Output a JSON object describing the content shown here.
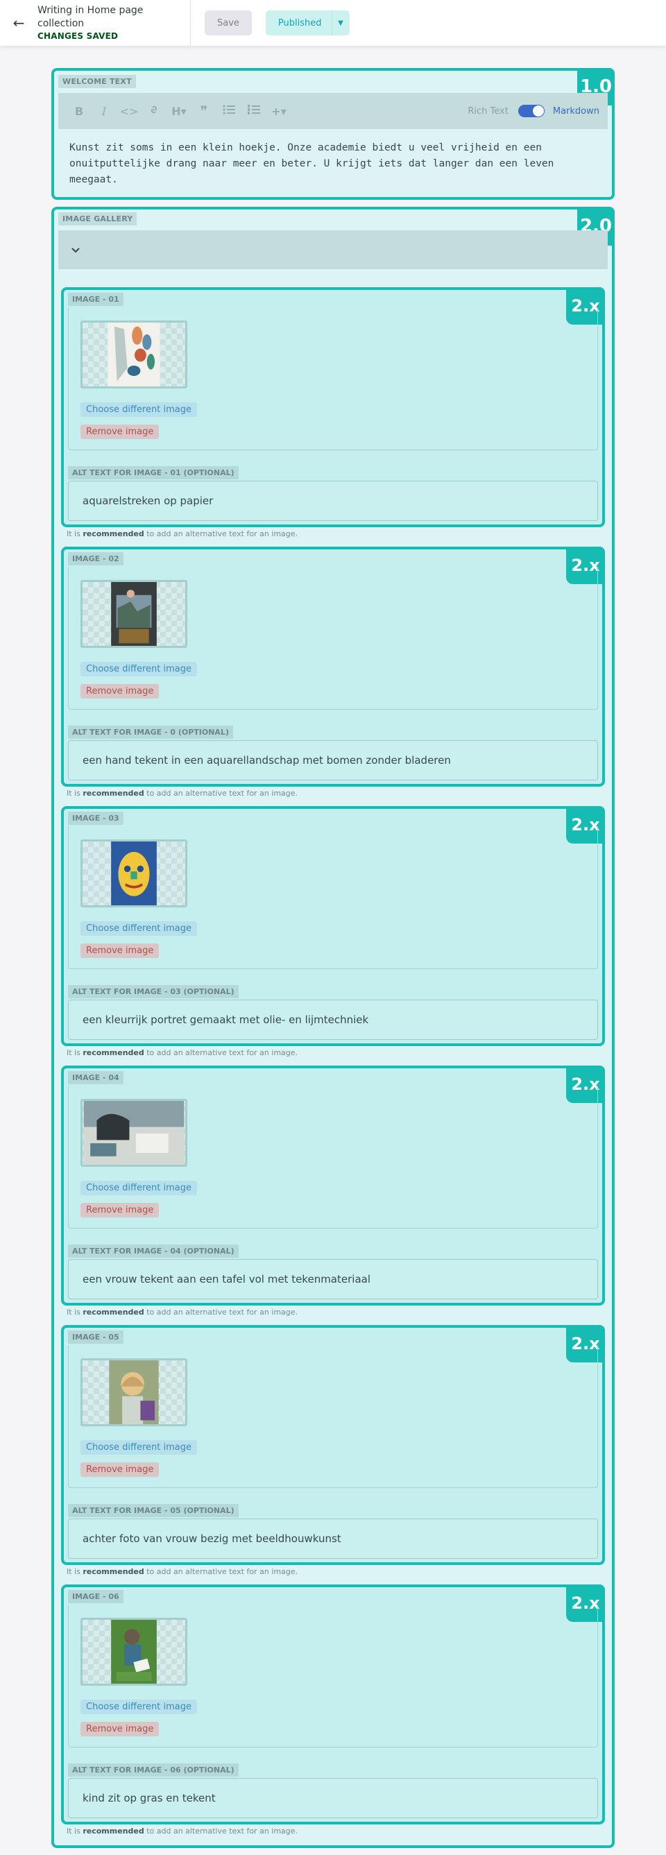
{
  "topbar": {
    "back_icon": "arrow-left-icon",
    "back_glyph": "←",
    "title": "Writing in Home page collection",
    "status": "CHANGES SAVED",
    "save_label": "Save",
    "publish_label": "Published",
    "publish_caret": "▼"
  },
  "welcome": {
    "label": "WELCOME TEXT",
    "badge": "1.0",
    "toolbar": {
      "bold": "B",
      "italic": "I",
      "code": "<>",
      "link": "🔗",
      "heading": "H▾",
      "quote": "❞",
      "bullets": "☰",
      "numbered": "☷",
      "add": "+▾",
      "rich_text": "Rich Text",
      "markdown": "Markdown"
    },
    "text": "Kunst zit soms in een klein hoekje. Onze academie biedt u veel vrijheid en een onuitputtelijke drang naar meer en beter. U krijgt iets dat langer dan een leven meegaat."
  },
  "gallery": {
    "label": "IMAGE GALLERY",
    "badge": "2.0",
    "collapse_glyph": "⌄",
    "choose_label": "Choose different image",
    "remove_label": "Remove image",
    "hint_prefix": "It is",
    "hint_bold": "recommended",
    "hint_suffix": "to add an alternative text for an image.",
    "item_badge": "2.x",
    "items": [
      {
        "label": "IMAGE - 01",
        "alt_label": "ALT TEXT FOR IMAGE - 01 (OPTIONAL)",
        "alt": "aquarelstreken op papier"
      },
      {
        "label": "IMAGE - 02",
        "alt_label": "ALT TEXT FOR IMAGE - 0 (OPTIONAL)",
        "alt": "een hand tekent in een aquarellandschap met bomen zonder bladeren"
      },
      {
        "label": "IMAGE - 03",
        "alt_label": "ALT TEXT FOR IMAGE - 03 (OPTIONAL)",
        "alt": "een kleurrijk portret gemaakt met olie- en lijmtechniek"
      },
      {
        "label": "IMAGE - 04",
        "alt_label": "ALT TEXT FOR IMAGE - 04 (OPTIONAL)",
        "alt": "een vrouw tekent aan een tafel vol met tekenmateriaal"
      },
      {
        "label": "IMAGE - 05",
        "alt_label": "ALT TEXT FOR IMAGE - 05 (OPTIONAL)",
        "alt": "achter foto van vrouw bezig met beeldhouwkunst"
      },
      {
        "label": "IMAGE - 06",
        "alt_label": "ALT TEXT FOR IMAGE - 06 (OPTIONAL)",
        "alt": "kind zit op gras en tekent"
      }
    ]
  },
  "colors": {
    "accent": "#16bcb2",
    "saved": "#005614",
    "markdown": "#3a69c7",
    "remove": "#b0504c",
    "choose": "#3b8bb6"
  }
}
